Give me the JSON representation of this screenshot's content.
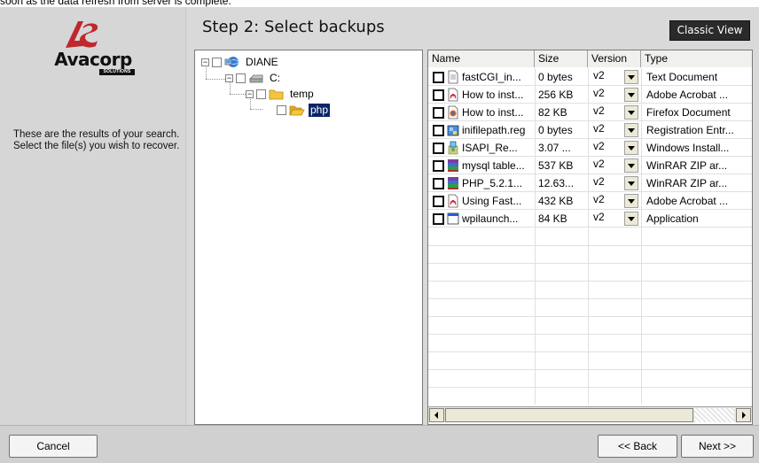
{
  "top_message": "soon as the data refresh from server is complete.",
  "branding": {
    "logo_text": "Avacorp",
    "logo_subtext": "SOLUTIONS",
    "logo_color": "#c0282d"
  },
  "description": "These are the results of your search. Select the file(s) you wish to recover.",
  "step_title": "Step 2: Select backups",
  "classic_view_label": "Classic View",
  "tree": {
    "nodes": [
      {
        "label": "DIANE",
        "icon": "network-computer-icon",
        "expanded": true,
        "level": 0
      },
      {
        "label": "C:",
        "icon": "drive-icon",
        "expanded": true,
        "level": 1
      },
      {
        "label": "temp",
        "icon": "folder-icon",
        "expanded": true,
        "level": 2
      },
      {
        "label": "php",
        "icon": "folder-open-icon",
        "expanded": false,
        "level": 3,
        "selected": true
      }
    ]
  },
  "file_list": {
    "columns": [
      "Name",
      "Size",
      "Version",
      "Type"
    ],
    "rows": [
      {
        "name": "fastCGI_in...",
        "size": "0 bytes",
        "version": "v2",
        "type": "Text Document",
        "icon": "text-document-icon"
      },
      {
        "name": "How to inst...",
        "size": "256 KB",
        "version": "v2",
        "type": "Adobe Acrobat ...",
        "icon": "pdf-icon"
      },
      {
        "name": "How to inst...",
        "size": "82 KB",
        "version": "v2",
        "type": "Firefox Document",
        "icon": "firefox-document-icon"
      },
      {
        "name": "inifilepath.reg",
        "size": "0 bytes",
        "version": "v2",
        "type": "Registration Entr...",
        "icon": "registry-icon"
      },
      {
        "name": "ISAPI_Re...",
        "size": "3.07 ...",
        "version": "v2",
        "type": "Windows Install...",
        "icon": "installer-icon"
      },
      {
        "name": "mysql table...",
        "size": "537 KB",
        "version": "v2",
        "type": "WinRAR ZIP ar...",
        "icon": "winrar-icon"
      },
      {
        "name": "PHP_5.2.1...",
        "size": "12.63...",
        "version": "v2",
        "type": "WinRAR ZIP ar...",
        "icon": "winrar-icon"
      },
      {
        "name": "Using Fast...",
        "size": "432 KB",
        "version": "v2",
        "type": "Adobe Acrobat ...",
        "icon": "pdf-icon"
      },
      {
        "name": "wpilaunch...",
        "size": "84 KB",
        "version": "v2",
        "type": "Application",
        "icon": "application-icon"
      }
    ]
  },
  "buttons": {
    "cancel": "Cancel",
    "back": "<< Back",
    "next": "Next >>"
  }
}
